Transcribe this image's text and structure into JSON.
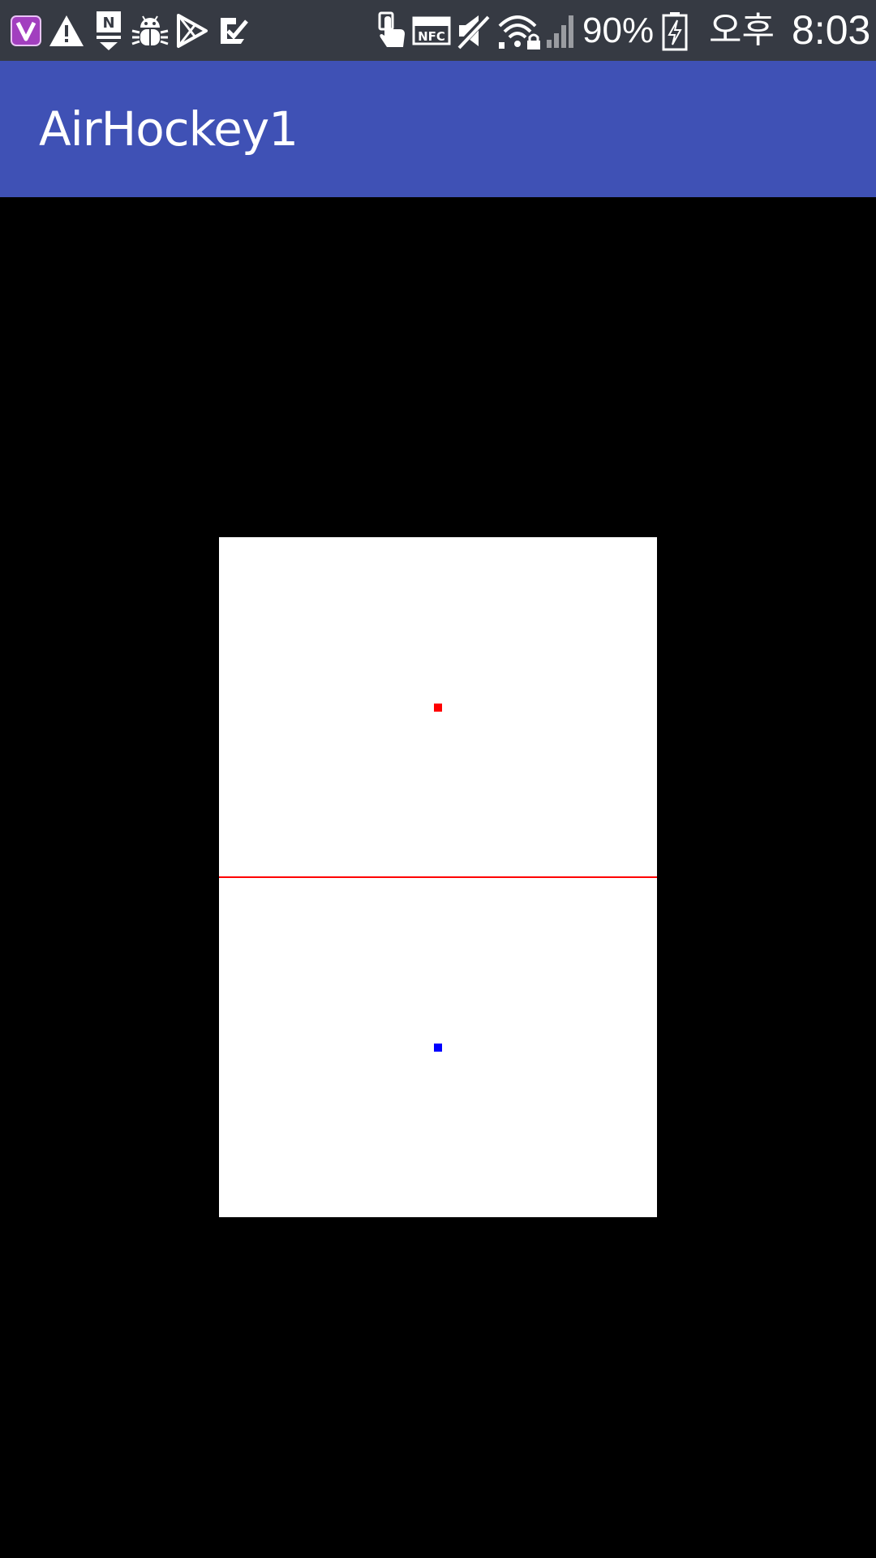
{
  "status_bar": {
    "left_icons": [
      "viber-icon",
      "warning-icon",
      "naver-download-icon",
      "android-debug-icon",
      "play-store-icon",
      "task-check-icon"
    ],
    "right_icons": [
      "touch-icon",
      "nfc-icon",
      "mute-icon",
      "wifi-locked-icon",
      "signal-icon",
      "battery-charging-icon"
    ],
    "nfc_label": "NFC",
    "battery_percent": "90%",
    "ampm": "오후",
    "time": "8:03"
  },
  "app_bar": {
    "title": "AirHockey1",
    "color": "#3f51b5"
  },
  "game": {
    "table_color": "#ffffff",
    "center_line_color": "#ff0000",
    "mallets": [
      {
        "name": "red-mallet",
        "color": "#ff0000"
      },
      {
        "name": "blue-mallet",
        "color": "#0000ff"
      }
    ]
  }
}
